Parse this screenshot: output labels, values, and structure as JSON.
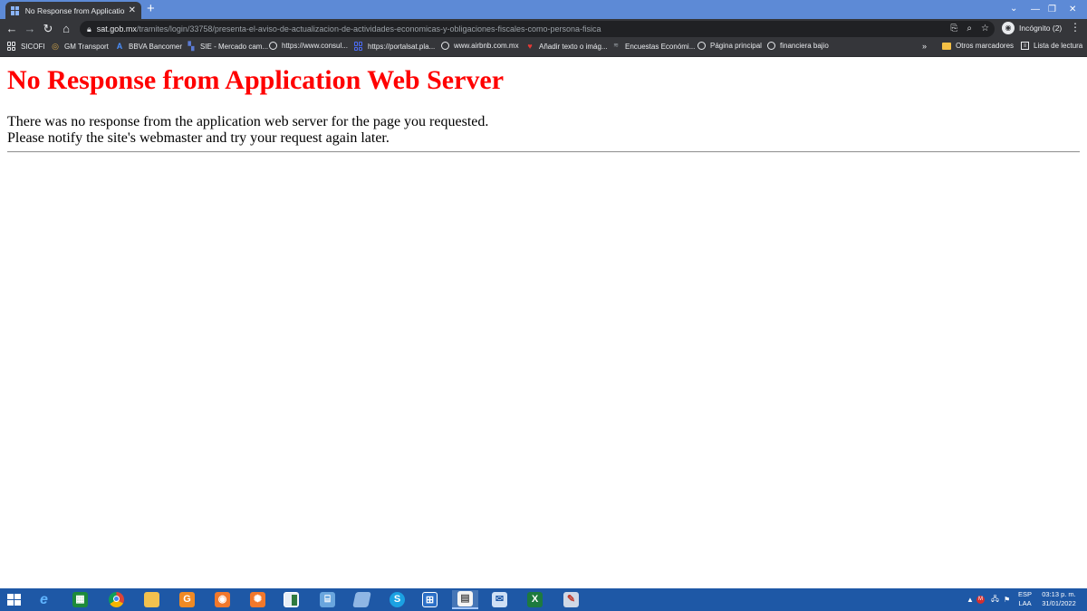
{
  "browser": {
    "tab_title": "No Response from Application W",
    "url_host": "sat.gob.mx",
    "url_path": "/tramites/login/33758/presenta-el-aviso-de-actualizacion-de-actividades-economicas-y-obligaciones-fiscales-como-persona-fisica",
    "profile_label": "Incógnito (2)"
  },
  "bookmarks": [
    {
      "label": "SICOFI",
      "icon": "apps-icon"
    },
    {
      "label": "GM Transport",
      "icon": "swirl-icon"
    },
    {
      "label": "BBVA Bancomer",
      "icon": "bbva-icon"
    },
    {
      "label": "SIE - Mercado cam...",
      "icon": "chart-icon"
    },
    {
      "label": "https://www.consul...",
      "icon": "globe-icon"
    },
    {
      "label": "https://portalsat.pla...",
      "icon": "grid-icon"
    },
    {
      "label": "www.airbnb.com.mx",
      "icon": "globe-icon"
    },
    {
      "label": "Añadir texto o imág...",
      "icon": "heart-icon"
    },
    {
      "label": "Encuestas Económi...",
      "icon": "survey-icon"
    },
    {
      "label": "Página principal",
      "icon": "globe-icon"
    },
    {
      "label": "financiera bajio",
      "icon": "globe-icon"
    }
  ],
  "bookmarks_right": {
    "other": "Otros marcadores",
    "reading_list": "Lista de lectura"
  },
  "page": {
    "heading": "No Response from Application Web Server",
    "line1": "There was no response from the application web server for the page you requested.",
    "line2": "Please notify the site's webmaster and try your request again later."
  },
  "taskbar": {
    "apps": [
      {
        "name": "internet-explorer",
        "active": false
      },
      {
        "name": "spreadsheet-app",
        "active": false
      },
      {
        "name": "chrome",
        "active": false
      },
      {
        "name": "file-explorer",
        "active": false
      },
      {
        "name": "app-g",
        "active": false
      },
      {
        "name": "camera-app-1",
        "active": false
      },
      {
        "name": "camera-app-2",
        "active": false
      },
      {
        "name": "window-app",
        "active": false
      },
      {
        "name": "network-app",
        "active": false
      },
      {
        "name": "book-app",
        "active": false
      },
      {
        "name": "skype",
        "active": false
      },
      {
        "name": "grid-app",
        "active": false
      },
      {
        "name": "document-app",
        "active": true
      },
      {
        "name": "mail-app",
        "active": false
      },
      {
        "name": "excel",
        "active": false
      },
      {
        "name": "paint-app",
        "active": false
      }
    ],
    "language": "ESP",
    "layout": "LAA",
    "time": "03:13 p. m.",
    "date": "31/01/2022"
  }
}
